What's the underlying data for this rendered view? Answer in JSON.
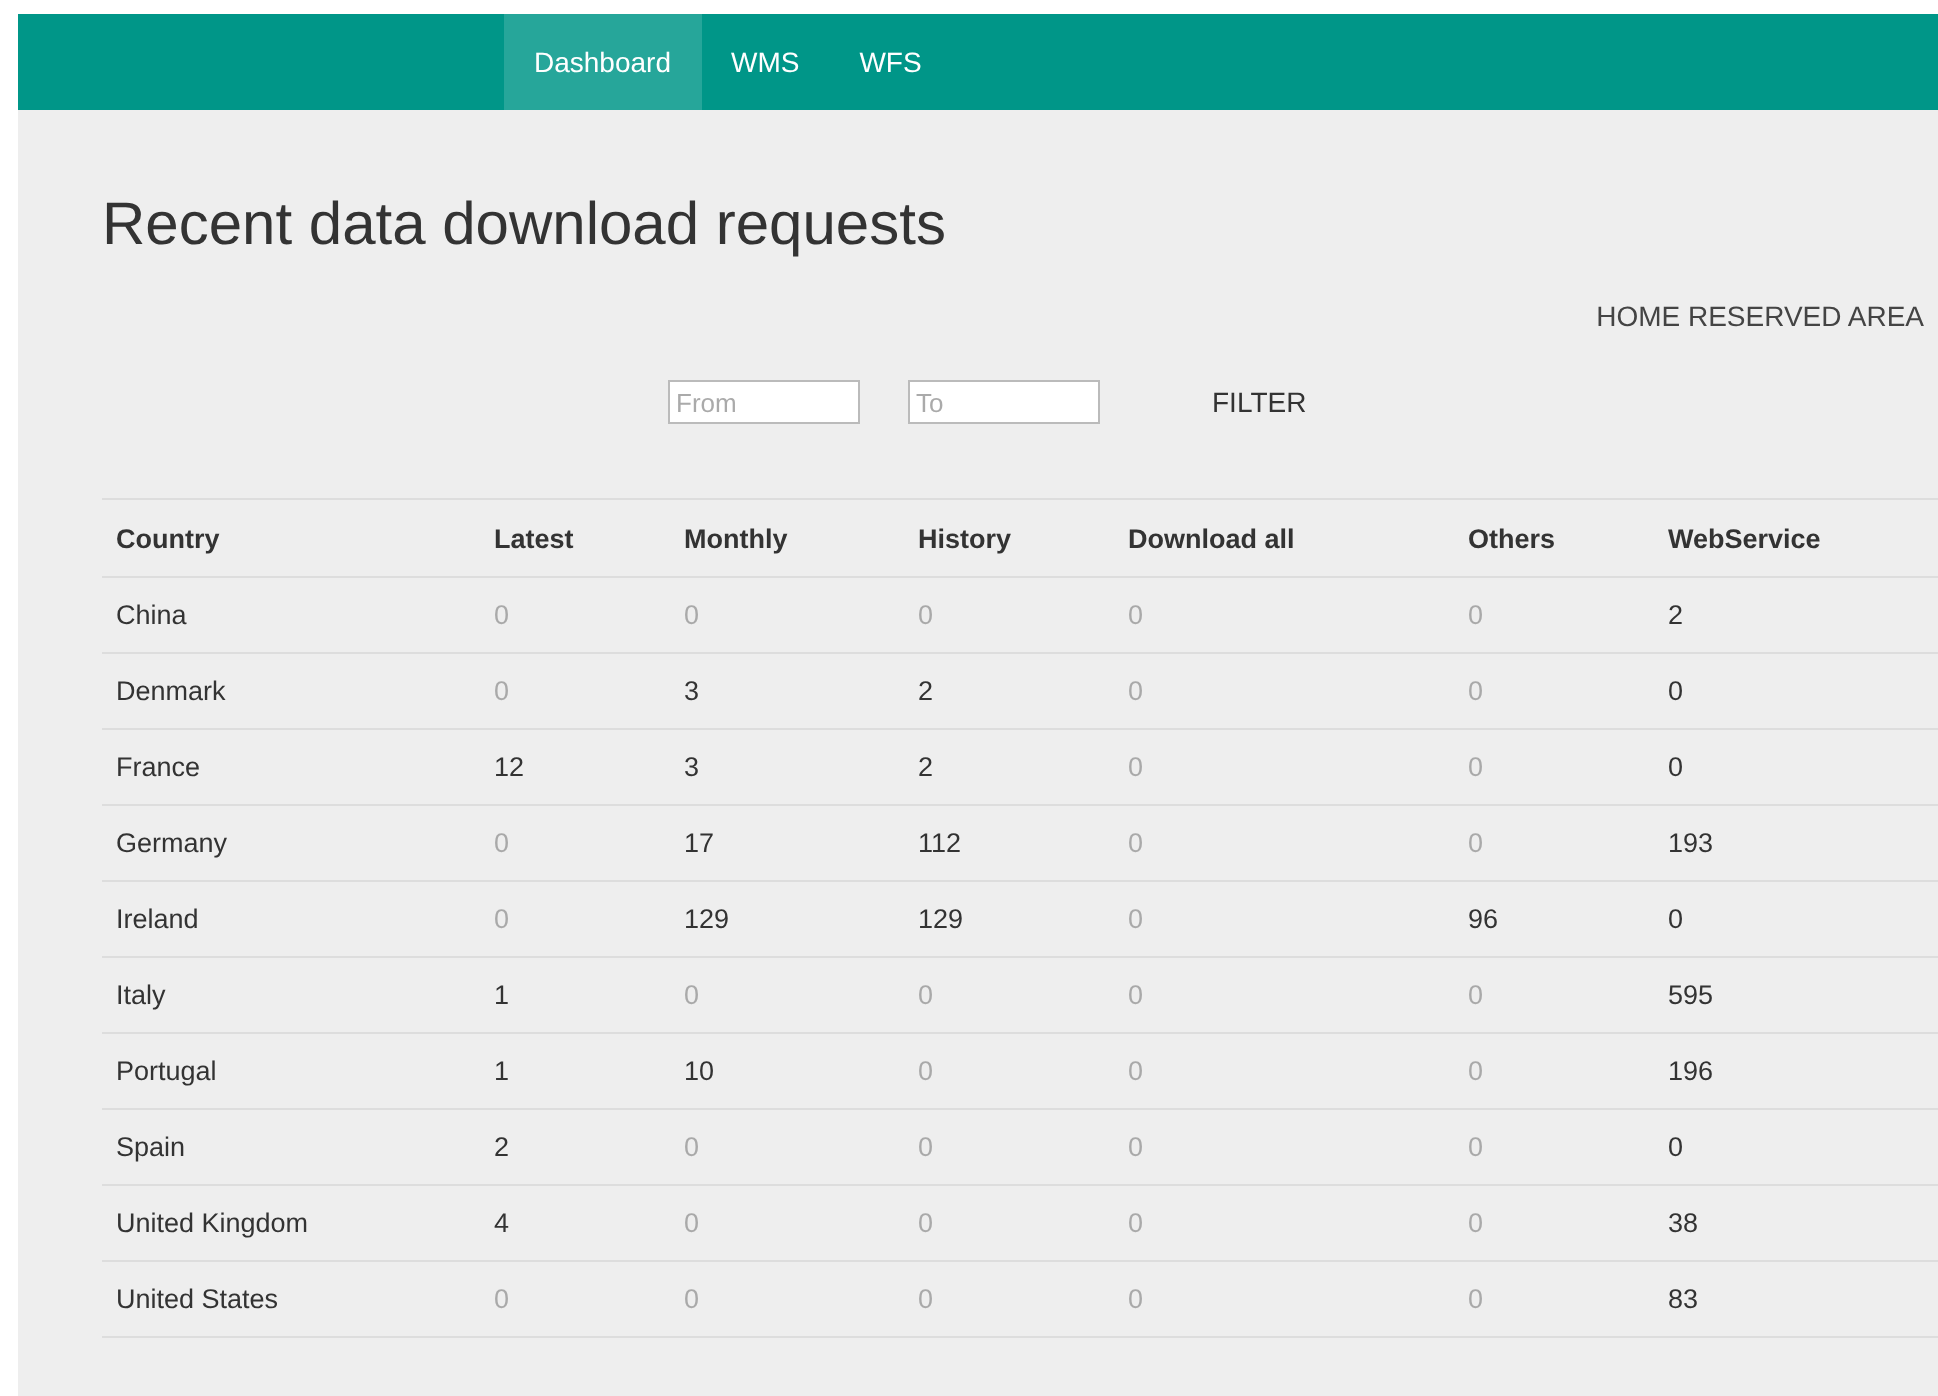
{
  "nav": [
    {
      "label": "Dashboard",
      "selected": true
    },
    {
      "label": "WMS",
      "selected": false
    },
    {
      "label": "WFS",
      "selected": false
    }
  ],
  "title": "Recent data download requests",
  "reserved_link": "HOME RESERVED AREA",
  "filter": {
    "from_placeholder": "From",
    "to_placeholder": "To",
    "button": "FILTER"
  },
  "table": {
    "columns": [
      "Country",
      "Latest",
      "Monthly",
      "History",
      "Download all",
      "Others",
      "WebService"
    ],
    "rows": [
      {
        "cells": [
          {
            "value": "China",
            "dimmed": false
          },
          {
            "value": "0",
            "dimmed": true
          },
          {
            "value": "0",
            "dimmed": true
          },
          {
            "value": "0",
            "dimmed": true
          },
          {
            "value": "0",
            "dimmed": true
          },
          {
            "value": "0",
            "dimmed": true
          },
          {
            "value": "2",
            "dimmed": false
          }
        ]
      },
      {
        "cells": [
          {
            "value": "Denmark",
            "dimmed": false
          },
          {
            "value": "0",
            "dimmed": true
          },
          {
            "value": "3",
            "dimmed": false
          },
          {
            "value": "2",
            "dimmed": false
          },
          {
            "value": "0",
            "dimmed": true
          },
          {
            "value": "0",
            "dimmed": true
          },
          {
            "value": "0",
            "dimmed": false
          }
        ]
      },
      {
        "cells": [
          {
            "value": "France",
            "dimmed": false
          },
          {
            "value": "12",
            "dimmed": false
          },
          {
            "value": "3",
            "dimmed": false
          },
          {
            "value": "2",
            "dimmed": false
          },
          {
            "value": "0",
            "dimmed": true
          },
          {
            "value": "0",
            "dimmed": true
          },
          {
            "value": "0",
            "dimmed": false
          }
        ]
      },
      {
        "cells": [
          {
            "value": "Germany",
            "dimmed": false
          },
          {
            "value": "0",
            "dimmed": true
          },
          {
            "value": "17",
            "dimmed": false
          },
          {
            "value": "112",
            "dimmed": false
          },
          {
            "value": "0",
            "dimmed": true
          },
          {
            "value": "0",
            "dimmed": true
          },
          {
            "value": "193",
            "dimmed": false
          }
        ]
      },
      {
        "cells": [
          {
            "value": "Ireland",
            "dimmed": false
          },
          {
            "value": "0",
            "dimmed": true
          },
          {
            "value": "129",
            "dimmed": false
          },
          {
            "value": "129",
            "dimmed": false
          },
          {
            "value": "0",
            "dimmed": true
          },
          {
            "value": "96",
            "dimmed": false
          },
          {
            "value": "0",
            "dimmed": false
          }
        ]
      },
      {
        "cells": [
          {
            "value": "Italy",
            "dimmed": false
          },
          {
            "value": "1",
            "dimmed": false
          },
          {
            "value": "0",
            "dimmed": true
          },
          {
            "value": "0",
            "dimmed": true
          },
          {
            "value": "0",
            "dimmed": true
          },
          {
            "value": "0",
            "dimmed": true
          },
          {
            "value": "595",
            "dimmed": false
          }
        ]
      },
      {
        "cells": [
          {
            "value": "Portugal",
            "dimmed": false
          },
          {
            "value": "1",
            "dimmed": false
          },
          {
            "value": "10",
            "dimmed": false
          },
          {
            "value": "0",
            "dimmed": true
          },
          {
            "value": "0",
            "dimmed": true
          },
          {
            "value": "0",
            "dimmed": true
          },
          {
            "value": "196",
            "dimmed": false
          }
        ]
      },
      {
        "cells": [
          {
            "value": "Spain",
            "dimmed": false
          },
          {
            "value": "2",
            "dimmed": false
          },
          {
            "value": "0",
            "dimmed": true
          },
          {
            "value": "0",
            "dimmed": true
          },
          {
            "value": "0",
            "dimmed": true
          },
          {
            "value": "0",
            "dimmed": true
          },
          {
            "value": "0",
            "dimmed": false
          }
        ]
      },
      {
        "cells": [
          {
            "value": "United Kingdom",
            "dimmed": false
          },
          {
            "value": "4",
            "dimmed": false
          },
          {
            "value": "0",
            "dimmed": true
          },
          {
            "value": "0",
            "dimmed": true
          },
          {
            "value": "0",
            "dimmed": true
          },
          {
            "value": "0",
            "dimmed": true
          },
          {
            "value": "38",
            "dimmed": false
          }
        ]
      },
      {
        "cells": [
          {
            "value": "United States",
            "dimmed": false
          },
          {
            "value": "0",
            "dimmed": true
          },
          {
            "value": "0",
            "dimmed": true
          },
          {
            "value": "0",
            "dimmed": true
          },
          {
            "value": "0",
            "dimmed": true
          },
          {
            "value": "0",
            "dimmed": true
          },
          {
            "value": "83",
            "dimmed": false
          }
        ]
      }
    ]
  }
}
